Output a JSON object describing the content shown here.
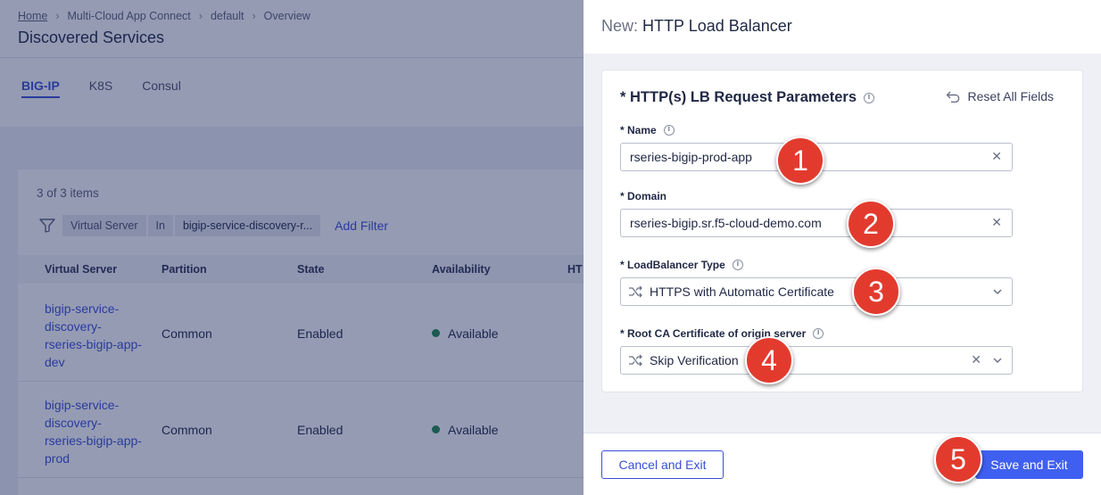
{
  "breadcrumb": [
    "Home",
    "Multi-Cloud App Connect",
    "default",
    "Overview"
  ],
  "page_title": "Discovered Services",
  "tabs": [
    "BIG-IP",
    "K8S",
    "Consul"
  ],
  "item_count": "3 of 3 items",
  "filter": {
    "field": "Virtual Server",
    "operator": "In",
    "value": "bigip-service-discovery-r...",
    "add_label": "Add Filter"
  },
  "table": {
    "columns": [
      "Virtual Server",
      "Partition",
      "State",
      "Availability",
      "HT"
    ],
    "rows": [
      {
        "virtual_server": "bigip-service-discovery-rseries-bigip-app-dev",
        "partition": "Common",
        "state": "Enabled",
        "availability": "Available"
      },
      {
        "virtual_server": "bigip-service-discovery-rseries-bigip-app-prod",
        "partition": "Common",
        "state": "Enabled",
        "availability": "Available"
      }
    ]
  },
  "panel": {
    "title_prefix": "New:",
    "title": "HTTP Load Balancer",
    "section_title": "* HTTP(s) LB Request Parameters",
    "reset_label": "Reset All Fields",
    "fields": {
      "name": {
        "label": "* Name",
        "value": "rseries-bigip-prod-app"
      },
      "domain": {
        "label": "* Domain",
        "value": "rseries-bigip.sr.f5-cloud-demo.com"
      },
      "lb_type": {
        "label": "* LoadBalancer Type",
        "value": "HTTPS with Automatic Certificate"
      },
      "root_ca": {
        "label": "* Root CA Certificate of origin server",
        "value": "Skip Verification"
      }
    },
    "cancel_label": "Cancel and Exit",
    "save_label": "Save and Exit"
  },
  "markers": [
    "1",
    "2",
    "3",
    "4",
    "5"
  ],
  "colors": {
    "accent": "#3a4fd6",
    "primary_button": "#3f5ff0",
    "marker": "#e23b2e",
    "available": "#1f8a4c",
    "overlay": "#18245a"
  }
}
